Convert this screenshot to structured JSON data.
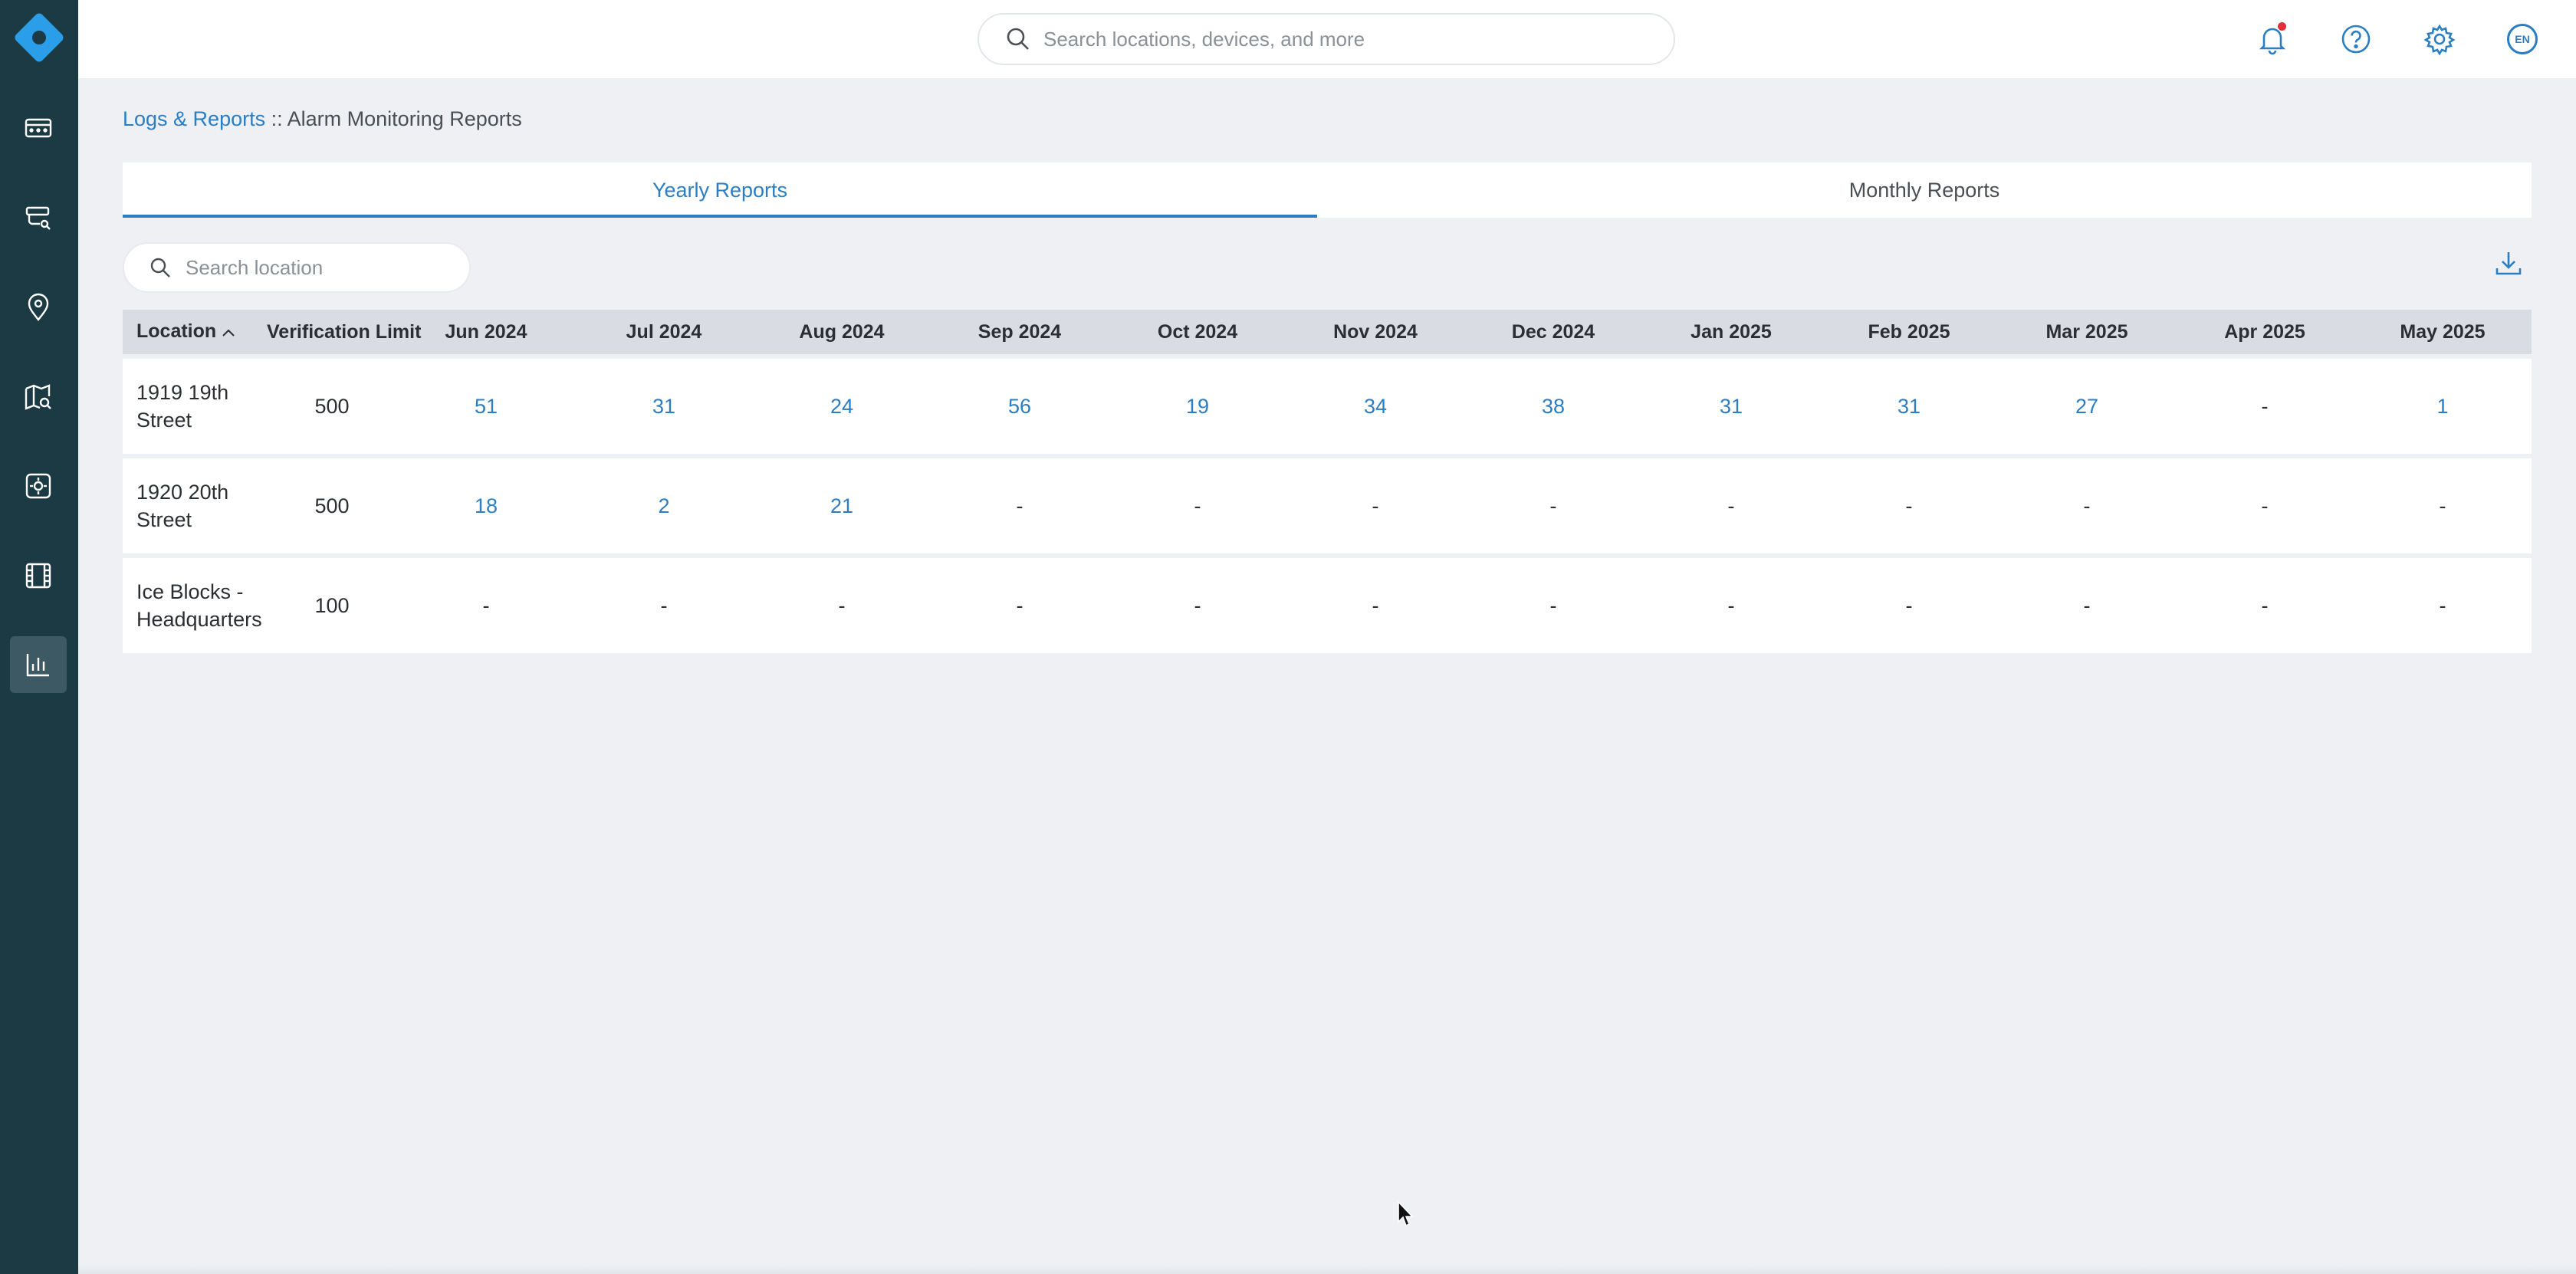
{
  "colors": {
    "sidebar_bg": "#1c3a44",
    "accent": "#2a7ec4",
    "page_bg": "#eef0f4",
    "notification_dot": "#e0303a"
  },
  "sidebar": {
    "items": [
      {
        "icon": "dashboard-icon",
        "active": false
      },
      {
        "icon": "camera-icon",
        "active": false
      },
      {
        "icon": "location-pin-icon",
        "active": false
      },
      {
        "icon": "map-search-icon",
        "active": false
      },
      {
        "icon": "devices-icon",
        "active": false
      },
      {
        "icon": "film-icon",
        "active": false
      },
      {
        "icon": "bar-chart-icon",
        "active": true
      }
    ]
  },
  "topbar": {
    "search_placeholder": "Search locations, devices, and more",
    "language": "EN"
  },
  "breadcrumb": {
    "parent": "Logs & Reports",
    "separator": " :: ",
    "current": "Alarm Monitoring Reports"
  },
  "tabs": [
    {
      "label": "Yearly Reports",
      "active": true
    },
    {
      "label": "Monthly Reports",
      "active": false
    }
  ],
  "location_search": {
    "placeholder": "Search location"
  },
  "table": {
    "headers": {
      "location": "Location",
      "verification_limit": "Verification Limit",
      "months": [
        "Jun 2024",
        "Jul 2024",
        "Aug 2024",
        "Sep 2024",
        "Oct 2024",
        "Nov 2024",
        "Dec 2024",
        "Jan 2025",
        "Feb 2025",
        "Mar 2025",
        "Apr 2025",
        "May 2025"
      ]
    },
    "rows": [
      {
        "location_line1": "1919 19th",
        "location_line2": "Street",
        "verification_limit": "500",
        "values": [
          "51",
          "31",
          "24",
          "56",
          "19",
          "34",
          "38",
          "31",
          "31",
          "27",
          "-",
          "1"
        ]
      },
      {
        "location_line1": "1920 20th",
        "location_line2": "Street",
        "verification_limit": "500",
        "values": [
          "18",
          "2",
          "21",
          "-",
          "-",
          "-",
          "-",
          "-",
          "-",
          "-",
          "-",
          "-"
        ]
      },
      {
        "location_line1": "Ice Blocks -",
        "location_line2": "Headquarters",
        "verification_limit": "100",
        "values": [
          "-",
          "-",
          "-",
          "-",
          "-",
          "-",
          "-",
          "-",
          "-",
          "-",
          "-",
          "-"
        ]
      }
    ]
  }
}
